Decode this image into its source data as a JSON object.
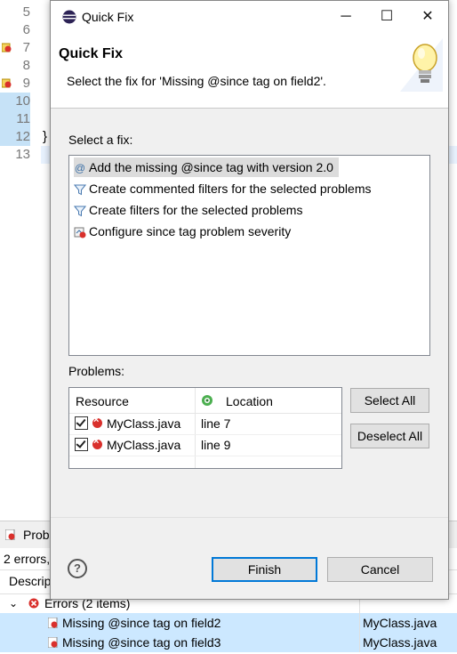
{
  "editor": {
    "line_numbers": [
      "5",
      "6",
      "7",
      "8",
      "9",
      "10",
      "11",
      "12",
      "13"
    ],
    "closing_brace": "}"
  },
  "problems_view": {
    "tab_label": "Prob",
    "status": "2 errors,",
    "column_description": "Descrip",
    "group_label": "Errors (2 items)",
    "rows": [
      {
        "description": "Missing @since tag on field2",
        "resource": "MyClass.java"
      },
      {
        "description": "Missing @since tag on field3",
        "resource": "MyClass.java"
      }
    ]
  },
  "dialog": {
    "window_title": "Quick Fix",
    "banner_title": "Quick Fix",
    "banner_message": "Select the fix for 'Missing @since tag on field2'.",
    "select_fix_label": "Select a fix:",
    "fixes": [
      {
        "label": "Add the missing @since tag with version 2.0",
        "icon": "at-sign-icon",
        "selected": true
      },
      {
        "label": "Create commented filters for the selected problems",
        "icon": "filter-icon",
        "selected": false
      },
      {
        "label": "Create filters for the selected problems",
        "icon": "filter-icon",
        "selected": false
      },
      {
        "label": "Configure since tag problem severity",
        "icon": "configure-icon",
        "selected": false
      }
    ],
    "problems_label": "Problems:",
    "problems_columns": {
      "resource": "Resource",
      "location": "Location"
    },
    "problems": [
      {
        "resource": "MyClass.java",
        "location": "line 7",
        "checked": true
      },
      {
        "resource": "MyClass.java",
        "location": "line 9",
        "checked": true
      }
    ],
    "select_all_label": "Select All",
    "deselect_all_label": "Deselect All",
    "finish_label": "Finish",
    "cancel_label": "Cancel",
    "help_glyph": "?",
    "window_controls": {
      "minimize": "─",
      "maximize": "☐",
      "close": "✕"
    }
  },
  "colors": {
    "error": "#d9302c",
    "selection": "#cce8ff",
    "default_button_border": "#0078d7"
  }
}
